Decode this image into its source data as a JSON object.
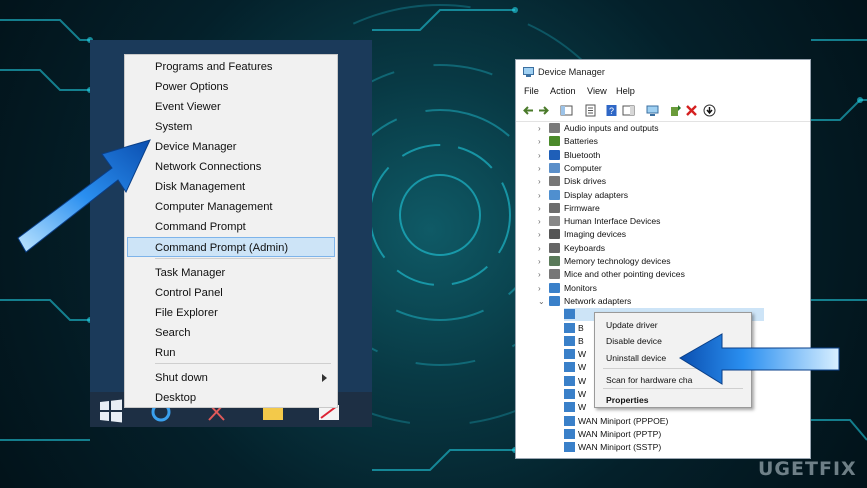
{
  "start_menu": {
    "items": [
      {
        "label": "Programs and Features"
      },
      {
        "label": "Power Options"
      },
      {
        "label": "Event Viewer"
      },
      {
        "label": "System"
      },
      {
        "label": "Device Manager"
      },
      {
        "label": "Network Connections"
      },
      {
        "label": "Disk Management"
      },
      {
        "label": "Computer Management"
      },
      {
        "label": "Command Prompt"
      },
      {
        "label": "Command Prompt (Admin)",
        "selected": true
      },
      {
        "label": "Task Manager"
      },
      {
        "label": "Control Panel"
      },
      {
        "label": "File Explorer"
      },
      {
        "label": "Search"
      },
      {
        "label": "Run"
      },
      {
        "label": "Shut down",
        "has_submenu": true
      },
      {
        "label": "Desktop"
      }
    ]
  },
  "device_manager": {
    "title": "Device Manager",
    "menu": [
      "File",
      "Action",
      "View",
      "Help"
    ],
    "categories": [
      {
        "label": "Audio inputs and outputs",
        "icon": "speaker-icon"
      },
      {
        "label": "Batteries",
        "icon": "battery-icon"
      },
      {
        "label": "Bluetooth",
        "icon": "bluetooth-icon"
      },
      {
        "label": "Computer",
        "icon": "computer-icon"
      },
      {
        "label": "Disk drives",
        "icon": "disk-icon"
      },
      {
        "label": "Display adapters",
        "icon": "display-icon"
      },
      {
        "label": "Firmware",
        "icon": "chip-icon"
      },
      {
        "label": "Human Interface Devices",
        "icon": "hid-icon"
      },
      {
        "label": "Imaging devices",
        "icon": "camera-icon"
      },
      {
        "label": "Keyboards",
        "icon": "keyboard-icon"
      },
      {
        "label": "Memory technology devices",
        "icon": "memory-icon"
      },
      {
        "label": "Mice and other pointing devices",
        "icon": "mouse-icon"
      },
      {
        "label": "Monitors",
        "icon": "monitor-icon"
      },
      {
        "label": "Network adapters",
        "icon": "network-icon",
        "expanded": true
      }
    ],
    "network_children": [
      {
        "label": ""
      },
      {
        "label": "B"
      },
      {
        "label": "B"
      },
      {
        "label": "W"
      },
      {
        "label": "W"
      },
      {
        "label": "W"
      },
      {
        "label": "W"
      },
      {
        "label": "W"
      },
      {
        "label": "WAN Miniport (PPPOE)"
      },
      {
        "label": "WAN Miniport (PPTP)"
      },
      {
        "label": "WAN Miniport (SSTP)"
      }
    ],
    "context_menu": {
      "items": [
        {
          "label": "Update driver"
        },
        {
          "label": "Disable device"
        },
        {
          "label": "Uninstall device"
        },
        {
          "label": "Scan for hardware cha"
        },
        {
          "label": "Properties",
          "bold": true
        }
      ]
    }
  },
  "watermark": "UGETFIX",
  "colors": {
    "arrow": "#1f86e0",
    "selection": "#cde4f7",
    "start_bg": "#1b3a5a"
  }
}
